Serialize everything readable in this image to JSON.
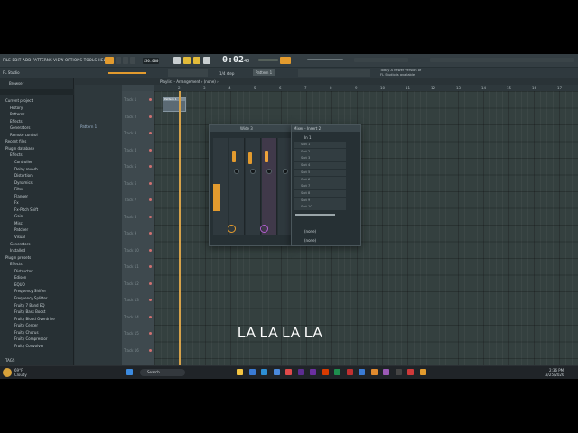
{
  "menubar": {
    "menu": "FILE EDIT ADD PATTERNS VIEW OPTIONS TOOLS HELP",
    "tempo": "130.000",
    "time": "0:02",
    "time_sub": "40"
  },
  "toolbar": {
    "pattern": "Pattern 1",
    "step": "1/4 step",
    "news": [
      "Today  A newer version of",
      "FL Studio is available!"
    ]
  },
  "browser": {
    "header": "Browser",
    "items": [
      "Current project",
      "History",
      "Patterns",
      "Effects",
      "Generators",
      "Remote control",
      "Recent files",
      "Plugin database",
      "Effects",
      "Controller",
      "Delay reverb",
      "Distortion",
      "Dynamics",
      "Filter",
      "Flanger",
      "Fx",
      "Fx-Pitch Shift",
      "Gain",
      "Misc",
      "Patcher",
      "Visual",
      "Generators",
      "Installed",
      "Plugin presets",
      "Effects",
      "Distructor",
      "Edison",
      "EQUO",
      "Frequency Shifter",
      "Frequency Splitter",
      "Fruity 7 Band EQ",
      "Fruity Bass Boost",
      "Fruity Blood Overdrive",
      "Fruity Center",
      "Fruity Chorus",
      "Fruity Compressor",
      "Fruity Convolver"
    ],
    "status": "TAGS"
  },
  "playlist": {
    "title": "Playlist - Arrangement › (none) ›",
    "pattern_item": "Pattern 1",
    "ruler": [
      "2",
      "3",
      "4",
      "5",
      "6",
      "7",
      "8",
      "9",
      "10",
      "11",
      "12",
      "13",
      "14",
      "15",
      "16",
      "17"
    ],
    "tracks": [
      "Track 1",
      "Track 2",
      "Track 3",
      "Track 4",
      "Track 5",
      "Track 6",
      "Track 7",
      "Track 8",
      "Track 9",
      "Track 10",
      "Track 11",
      "Track 12",
      "Track 13",
      "Track 14",
      "Track 15",
      "Track 16"
    ],
    "clip": "Pattern 1"
  },
  "mixer": {
    "title": "Mixer - Insert 2",
    "insert": "In 1",
    "slots": [
      "Slot 1",
      "Slot 2",
      "Slot 3",
      "Slot 4",
      "Slot 5",
      "Slot 6",
      "Slot 7",
      "Slot 8",
      "Slot 9",
      "Slot 10"
    ],
    "out1": "(none)",
    "out2": "(none)",
    "meter_label": "Wide 3"
  },
  "taskbar": {
    "weather_temp": "69°F",
    "weather_desc": "Cloudy",
    "search": "Search",
    "clock": "2:36 PM",
    "date": "3/25/2026"
  },
  "overlay": {
    "lyric": "LA LA LA LA"
  },
  "colors": {
    "accent": "#e39b2e",
    "playhead": "#d6a24a",
    "bg": "#2b3438"
  }
}
